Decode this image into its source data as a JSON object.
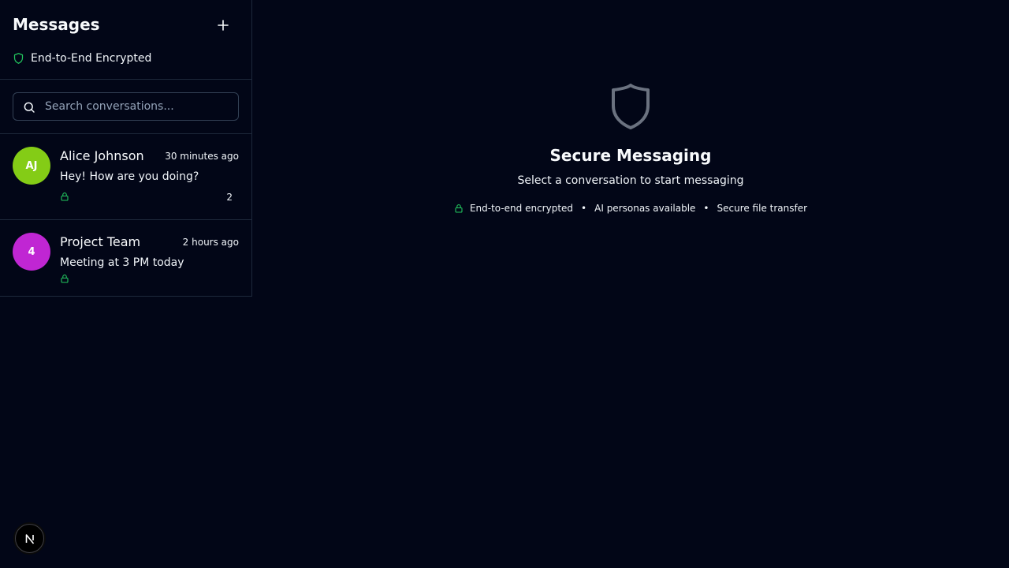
{
  "sidebar": {
    "title": "Messages",
    "encryption_label": "End-to-End Encrypted",
    "search": {
      "placeholder": "Search conversations..."
    },
    "conversations": [
      {
        "avatar_text": "AJ",
        "avatar_color": "#84cc16",
        "name": "Alice Johnson",
        "time": "30 minutes ago",
        "preview": "Hey! How are you doing?",
        "unread": "2"
      },
      {
        "avatar_text": "4",
        "avatar_color": "#c026d3",
        "name": "Project Team",
        "time": "2 hours ago",
        "preview": "Meeting at 3 PM today",
        "unread": ""
      }
    ]
  },
  "main": {
    "empty_icon": "shield-icon",
    "title": "Secure Messaging",
    "subtitle": "Select a conversation to start messaging",
    "features": [
      "End-to-end encrypted",
      "AI personas available",
      "Secure file transfer"
    ],
    "separator": "•"
  },
  "dev_badge": {
    "letter": "N"
  },
  "colors": {
    "accent_green": "#22c55e",
    "background": "#020617",
    "border": "#1e293b"
  }
}
